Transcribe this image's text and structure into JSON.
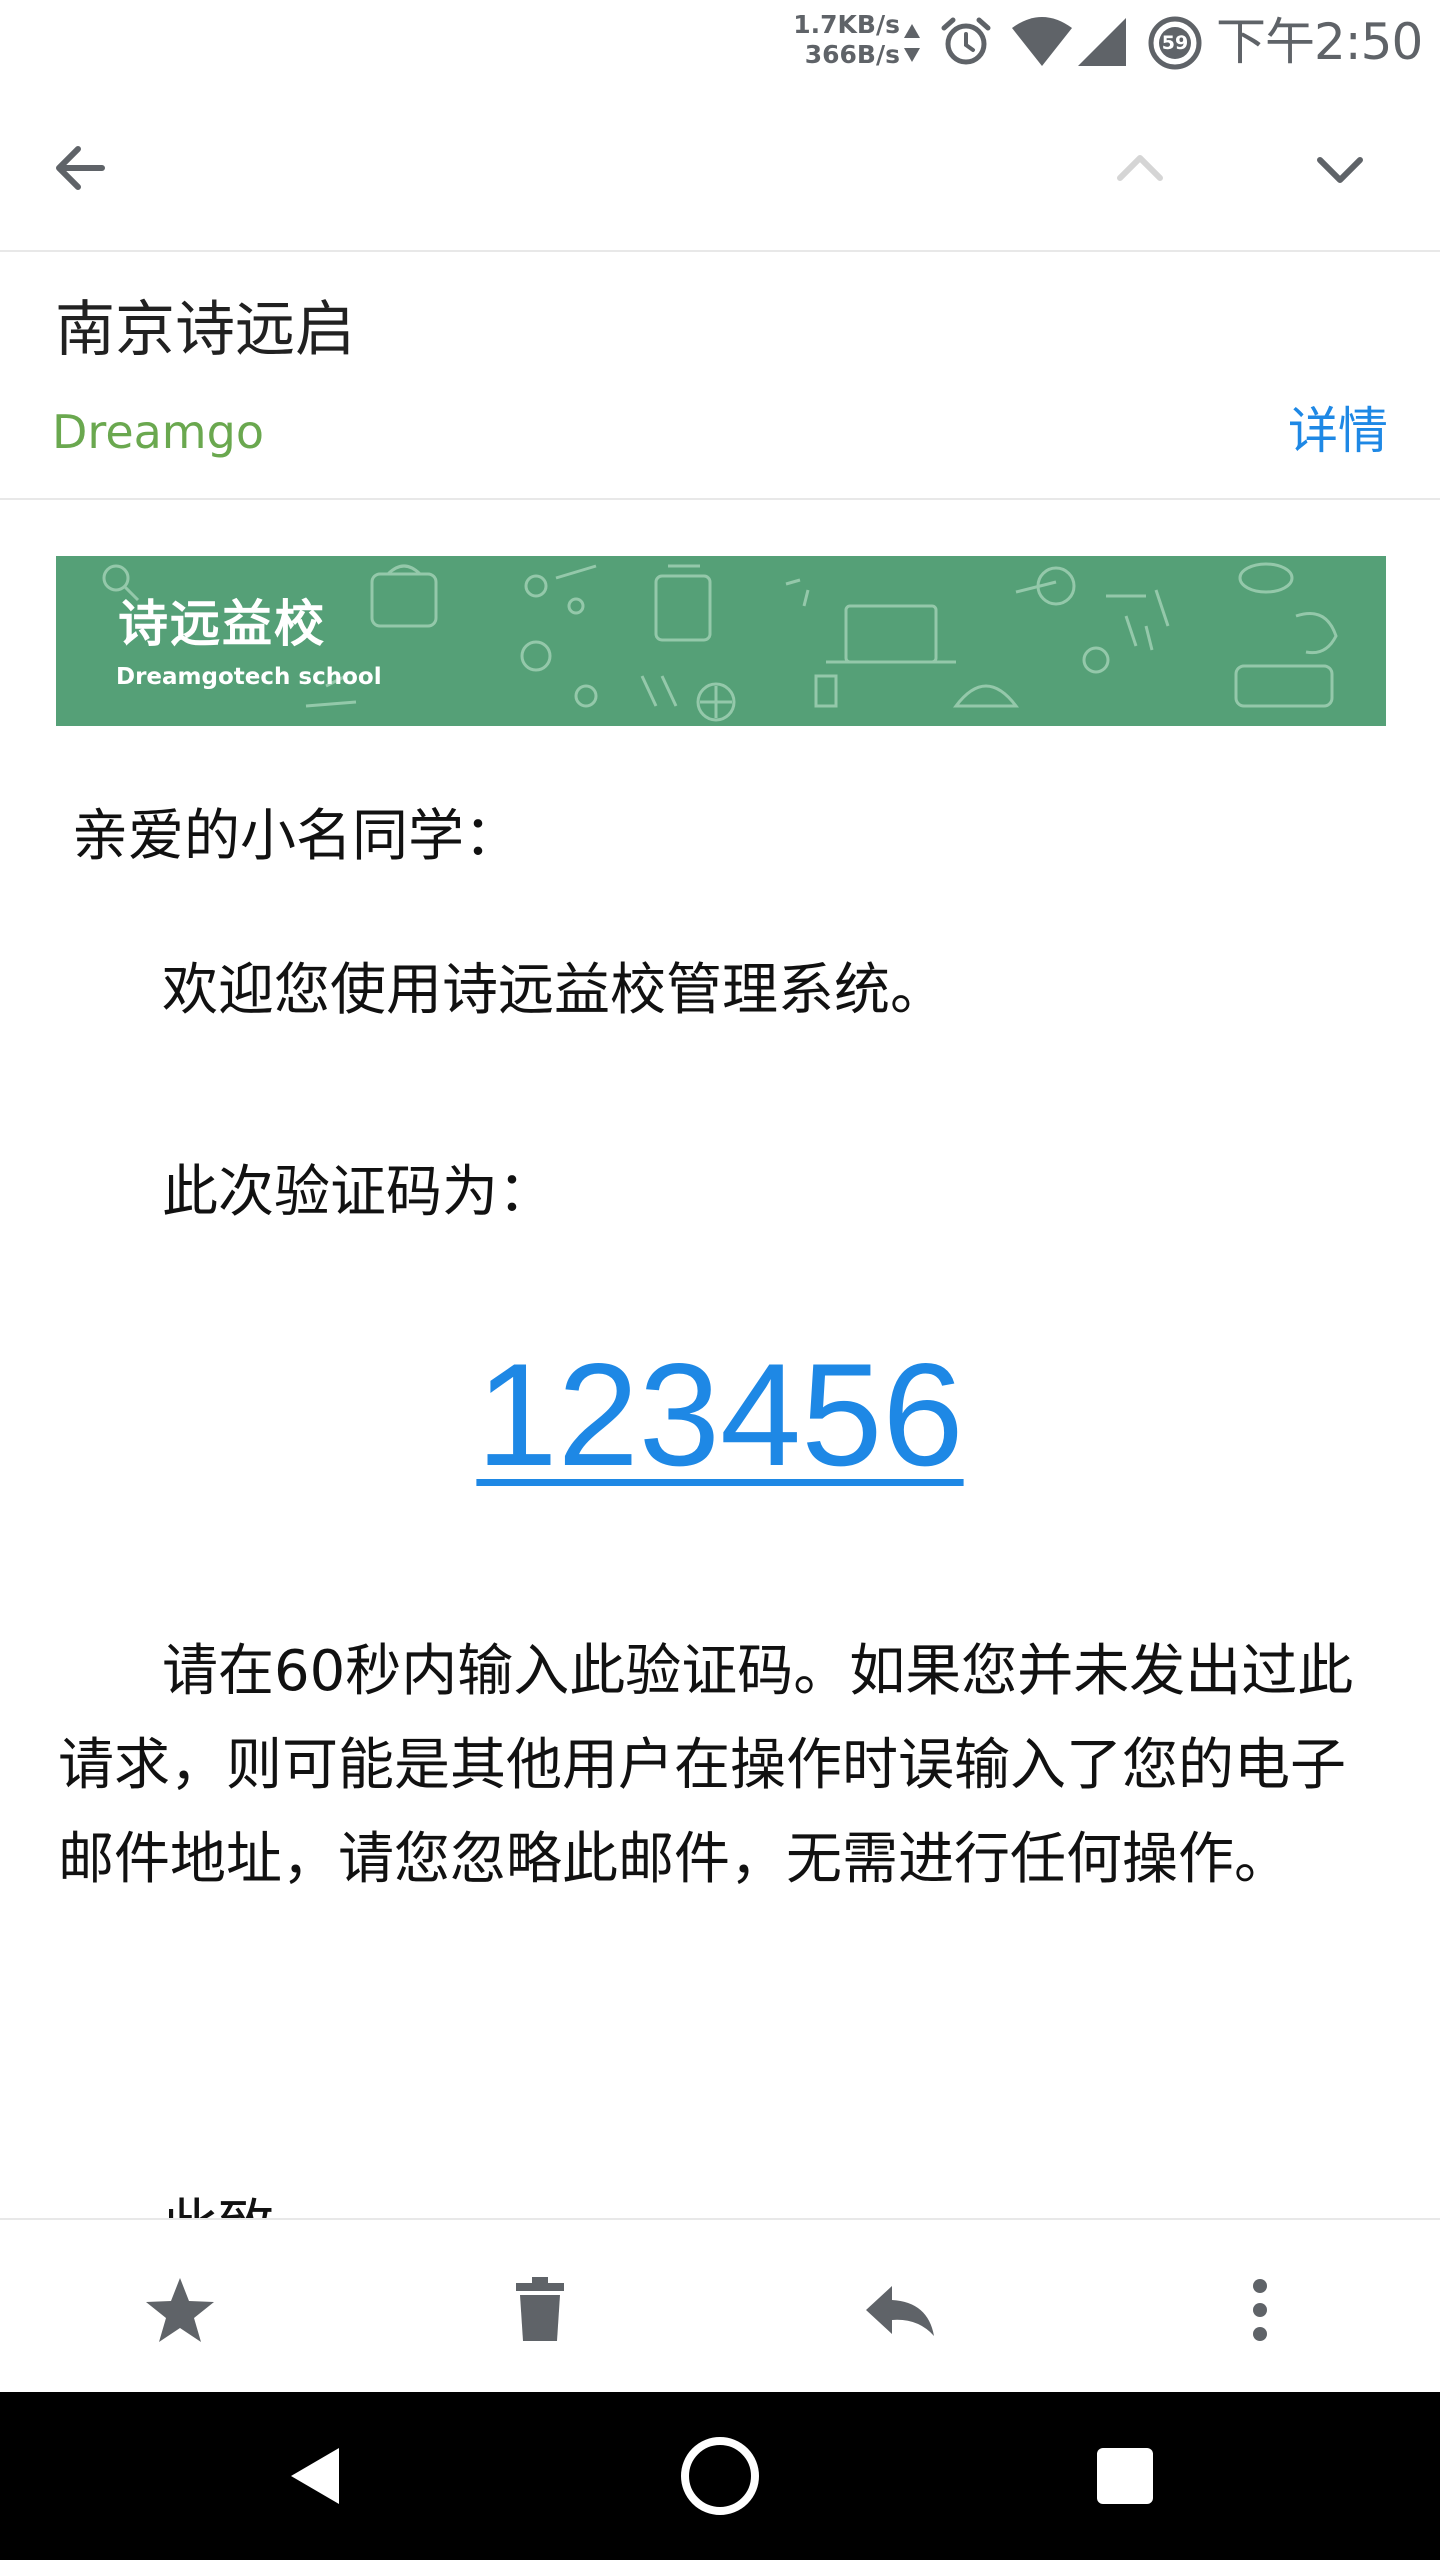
{
  "status_bar": {
    "net_up": "1.7KB/s",
    "net_down": "366B/s",
    "dnd_badge": "59",
    "time": "下午2:50",
    "icons": [
      "data-arrows-icon",
      "alarm-icon",
      "wifi-icon",
      "signal-icon",
      "dnd-icon"
    ]
  },
  "toolbar": {
    "back_icon": "arrow-back-icon",
    "prev_icon": "chevron-up-icon",
    "next_icon": "chevron-down-icon"
  },
  "email": {
    "subject": "南京诗远启",
    "sender": "Dreamgo",
    "details_label": "详情"
  },
  "banner": {
    "title": "诗远益校",
    "subtitle": "Dreamgotech school",
    "background_color": "#55a077"
  },
  "body": {
    "greeting": "亲爱的小名同学：",
    "welcome": "欢迎您使用诗远益校管理系统。",
    "code_label": "此次验证码为：",
    "code": "123456",
    "instructions": "请在60秒内输入此验证码。如果您并未发出过此请求，则可能是其他用户在操作时误输入了您的电子邮件地址，请您忽略此邮件，无需进行任何操作。",
    "closing": "此致"
  },
  "action_bar": {
    "icons": [
      "star-icon",
      "delete-icon",
      "reply-icon",
      "more-vert-icon"
    ]
  },
  "nav_bar": {
    "icons": [
      "nav-back-icon",
      "nav-home-icon",
      "nav-recents-icon"
    ]
  },
  "colors": {
    "accent_blue": "#1e88e5",
    "sender_green": "#6aa84f",
    "icon_gray": "#5f6368"
  }
}
